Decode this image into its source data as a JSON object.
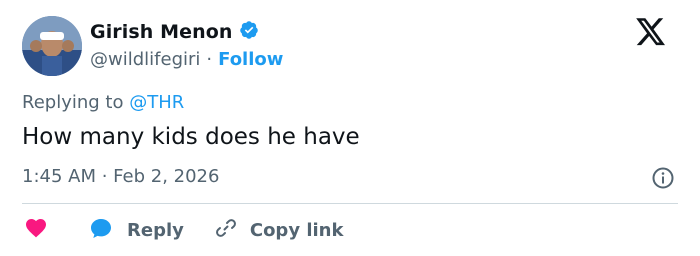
{
  "author": {
    "name": "Girish Menon",
    "handle": "@wildlifegiri",
    "separator": "·",
    "follow_label": "Follow",
    "verified_color": "#1d9bf0"
  },
  "reply": {
    "prefix": "Replying to ",
    "mention": "@THR"
  },
  "tweet_text": "How many kids does he have",
  "timestamp": "1:45 AM · Feb 2, 2026",
  "actions": {
    "like_icon": "heart-icon",
    "reply_label": "Reply",
    "copy_link_label": "Copy link"
  },
  "colors": {
    "accent": "#1d9bf0",
    "like": "#f91880",
    "muted_text": "#536471",
    "divider": "#cfd9de"
  }
}
